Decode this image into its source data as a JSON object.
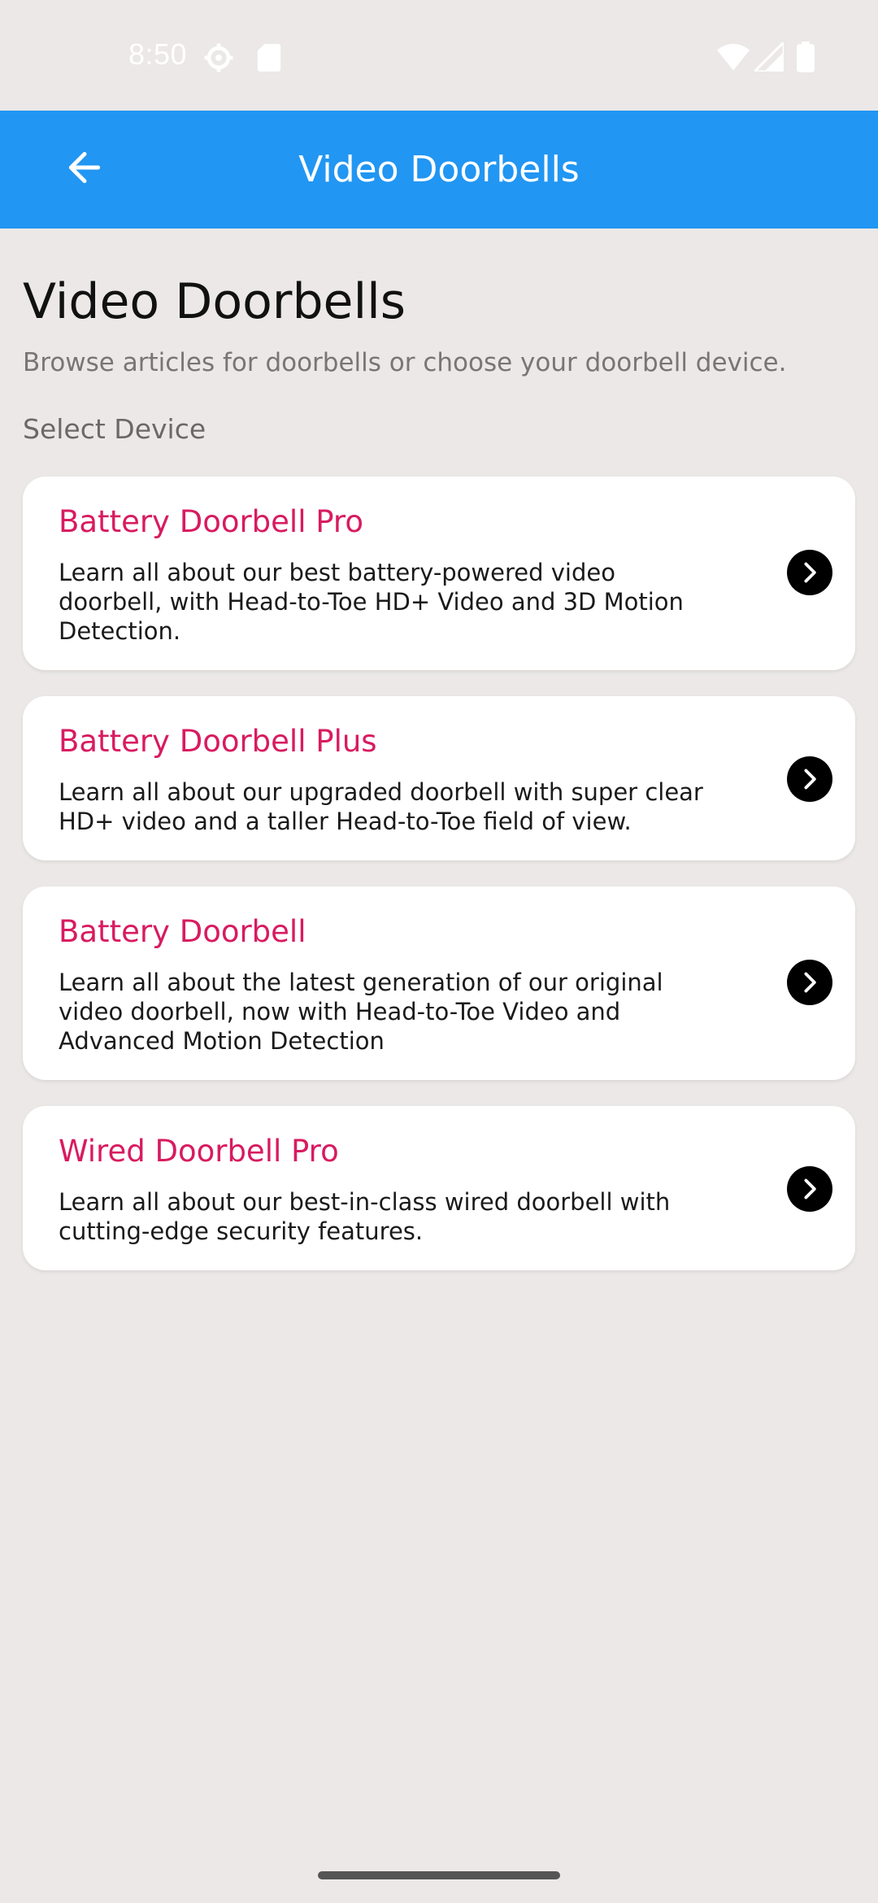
{
  "status_bar": {
    "time": "8:50",
    "left_icons": [
      "settings-icon",
      "sd-card-icon"
    ],
    "right_icons": [
      "wifi-icon",
      "cellular-signal-icon",
      "battery-icon"
    ]
  },
  "app_bar": {
    "title": "Video Doorbells",
    "back_icon": "arrow-left-icon"
  },
  "header": {
    "title": "Video Doorbells",
    "subtitle": "Browse articles for  doorbells or choose your doorbell device.",
    "section_label": "Select Device"
  },
  "devices": [
    {
      "title": "Battery Doorbell Pro",
      "description": "Learn all about our best battery-powered video\ndoorbell, with Head-to-Toe HD+ Video and 3D Motion\nDetection."
    },
    {
      "title": "Battery Doorbell Plus",
      "description": "Learn all about our upgraded doorbell with super clear\nHD+ video and a taller Head-to-Toe field of view."
    },
    {
      "title": "Battery Doorbell",
      "description": "Learn all about the latest generation of our original\nvideo doorbell, now with Head-to-Toe Video and\nAdvanced Motion Detection"
    },
    {
      "title": "Wired Doorbell Pro",
      "description": "Learn all about our best-in-class wired doorbell with\ncutting-edge security features."
    }
  ],
  "colors": {
    "app_bar": "#2196f3",
    "background": "#ebe8e7",
    "card_title": "#d81b60",
    "chevron_bg": "#000000"
  }
}
